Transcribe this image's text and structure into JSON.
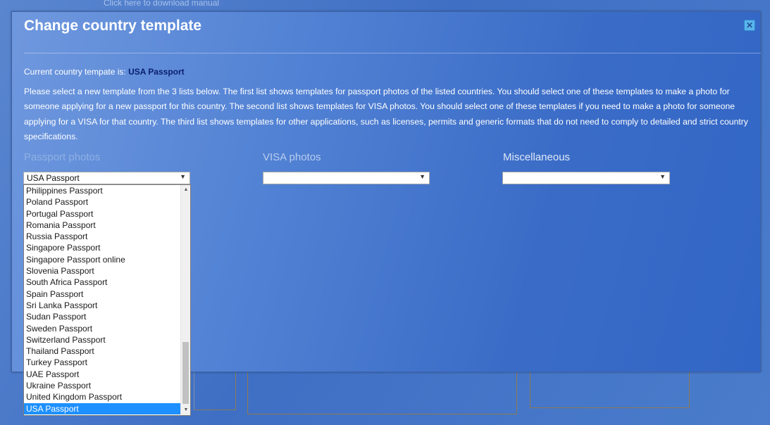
{
  "background": {
    "manual_link": "Click here to download manual"
  },
  "modal": {
    "title": "Change country template",
    "close_icon": "close-icon",
    "current_label": "Current country tempate is:",
    "current_value": "USA Passport",
    "description": "Please select a new template from the 3 lists below. The first list shows templates for passport photos of the listed countries. You should select one of these templates to make a photo for someone applying for a new passport for this country. The second list shows templates for VISA photos. You should select one of these templates if you need to make a photo for someone applying for a VISA for that country. The third list shows templates for other applications, such as licenses, permits and generic formats that do not need to comply to detailed and strict country specifications.",
    "columns": {
      "passport": {
        "label": "Passport photos",
        "selected": "USA Passport"
      },
      "visa": {
        "label": "VISA photos",
        "selected": ""
      },
      "misc": {
        "label": "Miscellaneous",
        "selected": ""
      }
    },
    "dropdown": {
      "items": [
        "Philippines Passport",
        "Poland Passport",
        "Portugal Passport",
        "Romania Passport",
        "Russia Passport",
        "Singapore Passport",
        "Singapore Passport online",
        "Slovenia Passport",
        "South Africa Passport",
        "Spain Passport",
        "Sri Lanka Passport",
        "Sudan Passport",
        "Sweden Passport",
        "Switzerland Passport",
        "Thailand Passport",
        "Turkey Passport",
        "UAE Passport",
        "Ukraine Passport",
        "United Kingdom Passport",
        "USA Passport"
      ],
      "selected_index": 19
    }
  },
  "colors": {
    "accent_selected": "#1e90ff",
    "current_value": "#0a1f6e"
  }
}
